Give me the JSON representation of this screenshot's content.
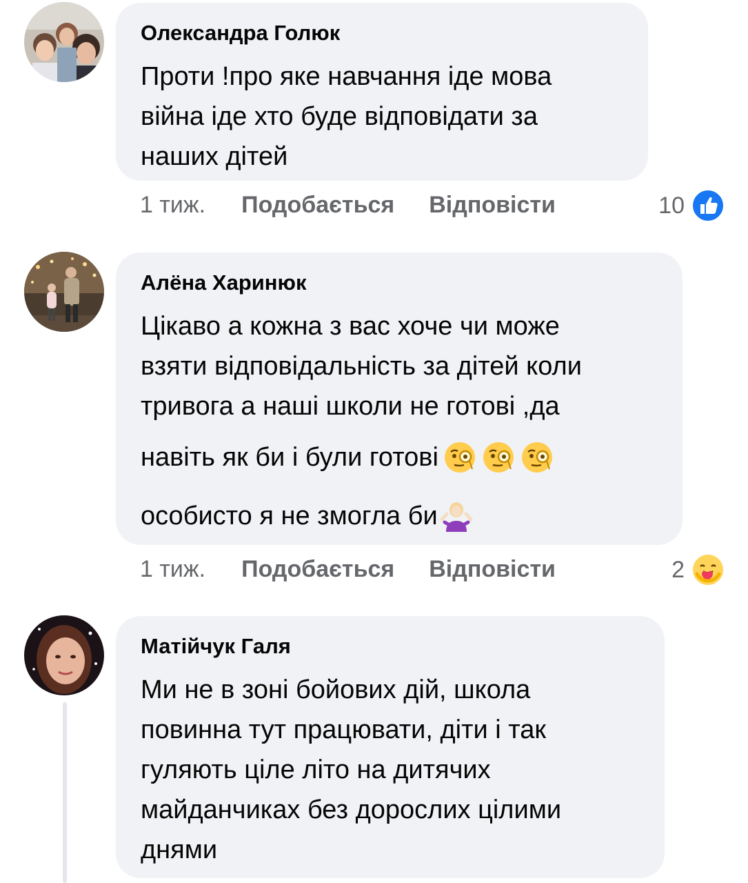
{
  "comments": [
    {
      "author": "Олександра Голюк",
      "text": "Проти !про яке навчання іде мова\nвійна іде хто буде відповідати за\nнаших дітей",
      "time": "1 тиж.",
      "like_label": "Подобається",
      "reply_label": "Відповісти",
      "reaction_count": "10",
      "reaction_icon": "like-icon"
    },
    {
      "author": "Алёна Харинюк",
      "text": "Цікаво а кожна з вас хоче чи може\nвзяти відповідальність за дітей коли\nтривога а наші школи не готові ,да",
      "text_line4": "навіть як би і були готові",
      "text_line5": "особисто я не змогла би",
      "time": "1 тиж.",
      "like_label": "Подобається",
      "reply_label": "Відповісти",
      "reaction_count": "2",
      "reaction_icon": "care-icon"
    },
    {
      "author": "Матійчук Галя",
      "text": "Ми не в зоні бойових дій, школа\nповинна тут працювати, діти і так\nгуляють ціле літо на дитячих\nмайданчиках без дорослих цілими\nднями"
    }
  ],
  "colors": {
    "bubble": "#f0f2f5",
    "meta_text": "#65676b",
    "like_blue": "#1877f2"
  }
}
